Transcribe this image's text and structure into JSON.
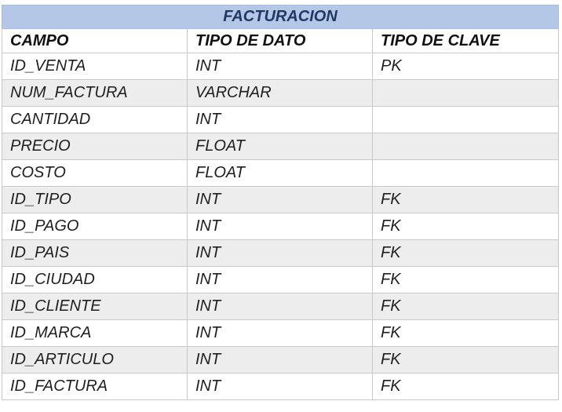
{
  "table": {
    "title": "FACTURACION",
    "headers": [
      "CAMPO",
      "TIPO DE DATO",
      "TIPO DE CLAVE"
    ],
    "rows": [
      [
        "ID_VENTA",
        "INT",
        "PK"
      ],
      [
        "NUM_FACTURA",
        "VARCHAR",
        ""
      ],
      [
        "CANTIDAD",
        "INT",
        ""
      ],
      [
        "PRECIO",
        "FLOAT",
        ""
      ],
      [
        "COSTO",
        "FLOAT",
        ""
      ],
      [
        "ID_TIPO",
        "INT",
        "FK"
      ],
      [
        "ID_PAGO",
        "INT",
        "FK"
      ],
      [
        "ID_PAIS",
        "INT",
        "FK"
      ],
      [
        "ID_CIUDAD",
        "INT",
        "FK"
      ],
      [
        "ID_CLIENTE",
        "INT",
        "FK"
      ],
      [
        "ID_MARCA",
        "INT",
        "FK"
      ],
      [
        "ID_ARTICULO",
        "INT",
        "FK"
      ],
      [
        "ID_FACTURA",
        "INT",
        "FK"
      ]
    ]
  },
  "colors": {
    "title_background": "#b4c7e7",
    "title_text": "#1f3864",
    "alternate_row_background": "#ededed",
    "border": "#c9c9c9"
  }
}
